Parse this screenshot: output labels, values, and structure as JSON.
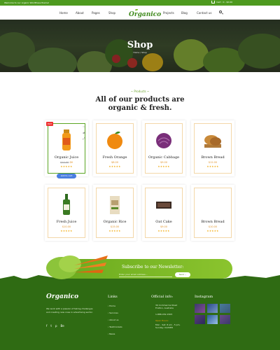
{
  "topbar": {
    "welcome": "Welcome to our organic WordPress theme!",
    "cart_summary": "Cart : 0 - $0.00"
  },
  "nav": {
    "home": "Home",
    "about": "About",
    "pages": "Pages",
    "shop": "Shop",
    "logo": "Organico",
    "projects": "Projects",
    "blog": "Blog",
    "contact": "Contact us"
  },
  "hero": {
    "title": "Shop",
    "breadcrumb_home": "Home",
    "breadcrumb_sep": "/",
    "breadcrumb_current": "Shop"
  },
  "products_section": {
    "kicker": "~ Products ~",
    "headline_line1": "All of our products are",
    "headline_line2": "organic & fresh."
  },
  "products": [
    {
      "name": "Organic Juice",
      "price_old": "$10.00",
      "price_new": "$6",
      "stars": "★★★★★",
      "badge": "HOT",
      "add_to_cart": "Add to cart"
    },
    {
      "name": "Fresh Orange",
      "price": "$8.00",
      "stars": "★★★★★"
    },
    {
      "name": "Organic Cabbage",
      "price": "$9.00",
      "stars": "★★★★★"
    },
    {
      "name": "Brown Bread",
      "price": "$12.00",
      "stars": "★★★★★"
    },
    {
      "name": "Fresh Juice",
      "price": "$10.00",
      "stars": "★★★★★"
    },
    {
      "name": "Organic Rice",
      "price": "$15.00",
      "stars": "★★★★★"
    },
    {
      "name": "Oat Cake",
      "price": "$9.00",
      "stars": "★★★★★"
    },
    {
      "name": "Brown Bread",
      "price": "$10.00",
      "stars": "★★★★★"
    }
  ],
  "newsletter": {
    "title": "Subscribe to our Newsletter:",
    "placeholder": "Enter your email address...",
    "button": "Send →"
  },
  "footer": {
    "logo": "Organico",
    "about_text": "We work with a passion of taking challenges and creating new ones in advertising sector.",
    "links_heading": "Links",
    "links": [
      "Home",
      "Services",
      "About us",
      "Testimonials",
      "News"
    ],
    "info_heading": "Official info:",
    "address": "30 Commercial Road Fratton, Australia",
    "phone": "1-888-452-1505",
    "open_hours_label": "Open Hours:",
    "open_hours": "Mon - Sat: 8 am - 5 pm, Sunday: CLOSED",
    "instagram_heading": "Instagram"
  },
  "colors": {
    "brand_green": "#4e9a1f",
    "footer_green": "#2f6b13",
    "accent_orange": "#e0932a",
    "star": "#f0a500"
  }
}
